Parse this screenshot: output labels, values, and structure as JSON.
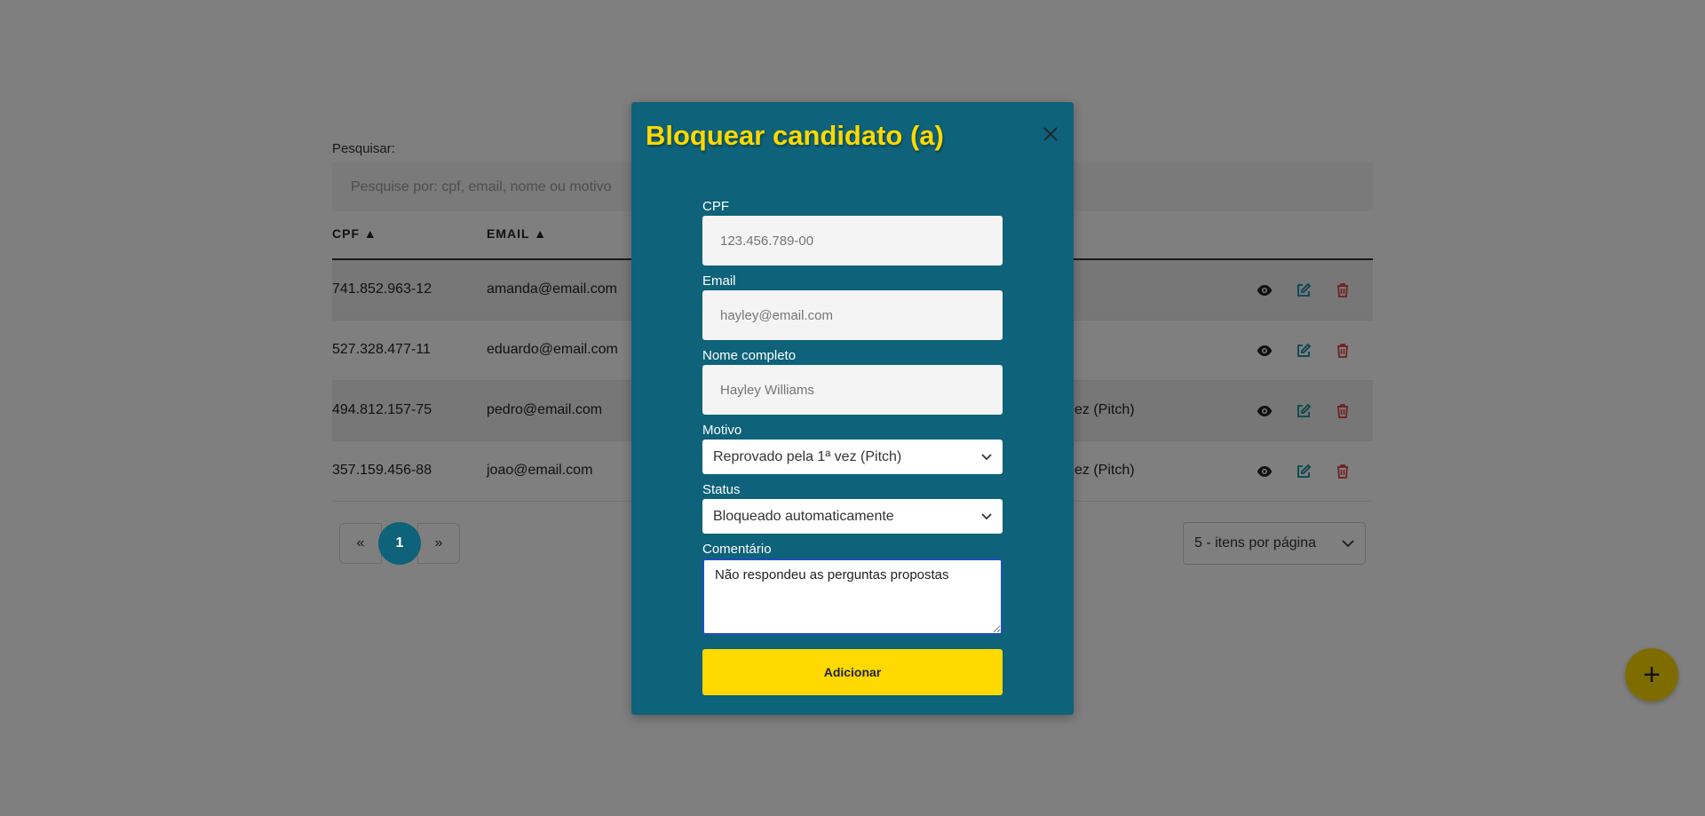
{
  "search": {
    "label": "Pesquisar:",
    "placeholder": "Pesquise por: cpf, email, nome ou motivo"
  },
  "table": {
    "headers": {
      "cpf": "CPF ▲",
      "email": "EMAIL ▲"
    },
    "rows": [
      {
        "cpf": "741.852.963-12",
        "email": "amanda@email.com",
        "motivo": ""
      },
      {
        "cpf": "527.328.477-11",
        "email": "eduardo@email.com",
        "motivo": ""
      },
      {
        "cpf": "494.812.157-75",
        "email": "pedro@email.com",
        "motivo": "ez (Pitch)"
      },
      {
        "cpf": "357.159.456-88",
        "email": "joao@email.com",
        "motivo": "ez (Pitch)"
      }
    ]
  },
  "pagination": {
    "prev": "«",
    "current": "1",
    "next": "»"
  },
  "per_page": {
    "value": "5 - itens por página"
  },
  "fab": {
    "label": "+"
  },
  "modal": {
    "title": "Bloquear candidato (a)",
    "cpf": {
      "label": "CPF",
      "placeholder": "123.456.789-00"
    },
    "email": {
      "label": "Email",
      "placeholder": "hayley@email.com"
    },
    "nome": {
      "label": "Nome completo",
      "placeholder": "Hayley Williams"
    },
    "motivo": {
      "label": "Motivo",
      "value": "Reprovado pela 1ª vez (Pitch)"
    },
    "status": {
      "label": "Status",
      "value": "Bloqueado automaticamente"
    },
    "comentario": {
      "label": "Comentário",
      "value": "Não respondeu as perguntas propostas"
    },
    "submit": "Adicionar"
  },
  "colors": {
    "modal_bg": "#0e6279",
    "accent": "#ffd900",
    "view_icon": "#222222",
    "edit_icon": "#0e8aa0",
    "delete_icon": "#e53935"
  }
}
